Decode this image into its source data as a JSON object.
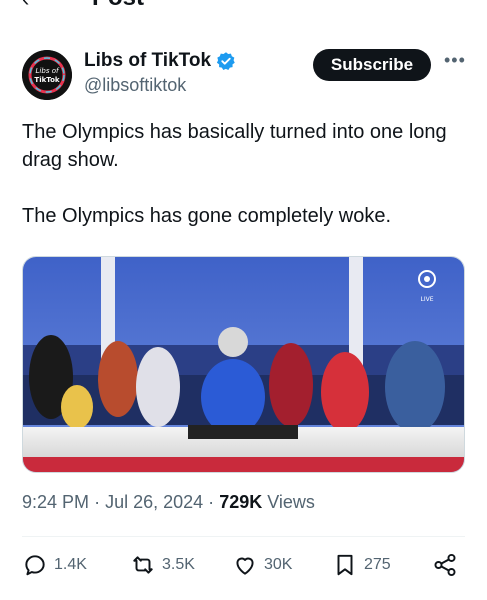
{
  "topbar": {
    "title": "Post"
  },
  "author": {
    "display_name": "Libs of TikTok",
    "handle": "@libsoftiktok",
    "avatar_text_1": "Libs of",
    "avatar_text_2": "TikTok",
    "verified_color": "#1d9bf0"
  },
  "subscribe_label": "Subscribe",
  "tweet": {
    "paragraph_1": "The Olympics has basically turned into one long drag show.",
    "paragraph_2": "The Olympics has gone completely woke."
  },
  "media": {
    "watermark": "LIVE"
  },
  "meta": {
    "time": "9:24 PM",
    "separator_1": "·",
    "date": "Jul 26, 2024",
    "separator_2": "·",
    "views_count": "729K",
    "views_label": "Views"
  },
  "actions": {
    "replies": "1.4K",
    "reposts": "3.5K",
    "likes": "30K",
    "bookmarks": "275"
  },
  "colors": {
    "text_primary": "#0f1419",
    "text_secondary": "#536471",
    "brand_blue": "#1d9bf0"
  }
}
